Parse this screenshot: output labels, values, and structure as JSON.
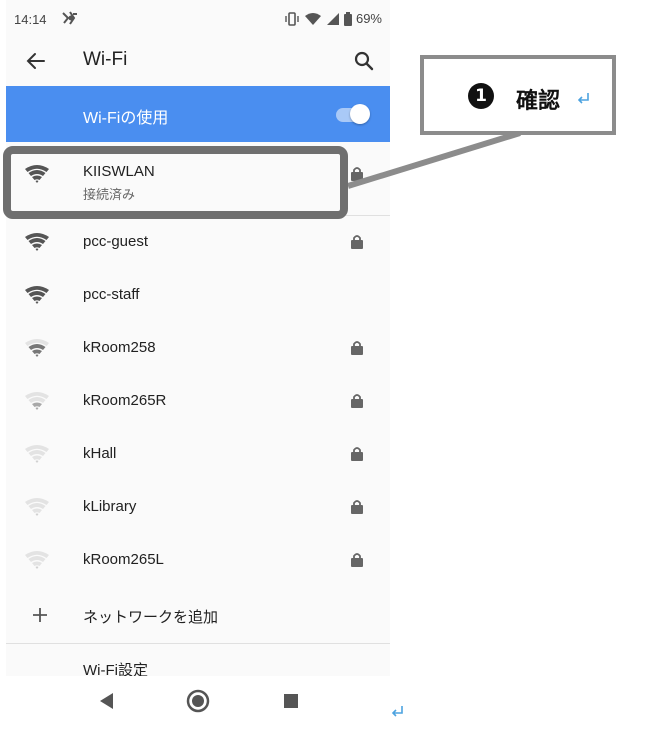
{
  "status_bar": {
    "time": "14:14",
    "battery": "69%",
    "icons": [
      "notification-app-icon",
      "vibrate-icon",
      "wifi-status-icon",
      "cell-signal-icon",
      "battery-icon"
    ]
  },
  "app_bar": {
    "title": "Wi-Fi",
    "back_icon": "arrow-back-icon",
    "search_icon": "search-icon"
  },
  "master_switch": {
    "label": "Wi-Fiの使用",
    "enabled": true,
    "accent_color": "#4a8ef0"
  },
  "networks": [
    {
      "ssid": "KIISWLAN",
      "status": "接続済み",
      "secured": true,
      "strength": 4,
      "connected": true
    },
    {
      "ssid": "pcc-guest",
      "status": "",
      "secured": true,
      "strength": 4,
      "connected": false
    },
    {
      "ssid": "pcc-staff",
      "status": "",
      "secured": false,
      "strength": 4,
      "connected": false
    },
    {
      "ssid": "kRoom258",
      "status": "",
      "secured": true,
      "strength": 3,
      "connected": false
    },
    {
      "ssid": "kRoom265R",
      "status": "",
      "secured": true,
      "strength": 2,
      "connected": false
    },
    {
      "ssid": "kHall",
      "status": "",
      "secured": true,
      "strength": 1,
      "connected": false
    },
    {
      "ssid": "kLibrary",
      "status": "",
      "secured": true,
      "strength": 1,
      "connected": false
    },
    {
      "ssid": "kRoom265L",
      "status": "",
      "secured": true,
      "strength": 1,
      "connected": false
    }
  ],
  "add_network": {
    "label": "ネットワークを追加"
  },
  "wifi_settings": {
    "label": "Wi-Fi設定"
  },
  "nav": {
    "icons": [
      "back-triangle-icon",
      "home-circle-icon",
      "recents-square-icon"
    ]
  },
  "callout": {
    "number": "❶",
    "number_plain": "1",
    "label": "確認",
    "border_color": "#8c8c8c"
  },
  "return_mark_color": "#4da3e0"
}
